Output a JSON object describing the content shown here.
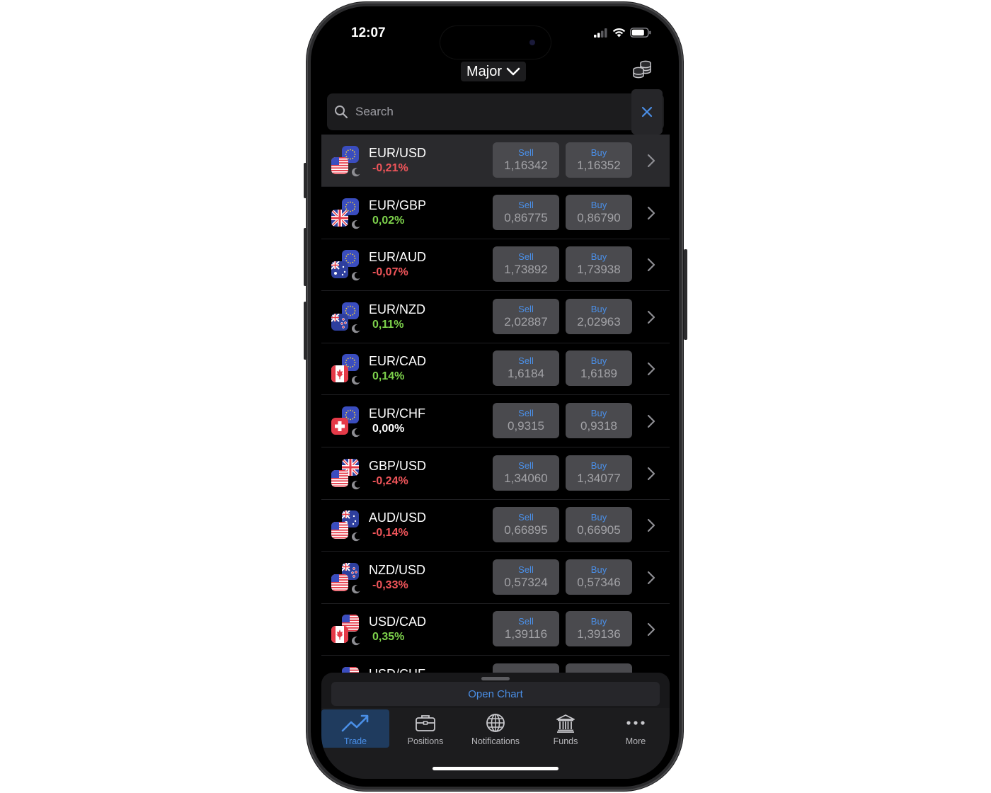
{
  "status": {
    "time": "12:07"
  },
  "header": {
    "market": "Major"
  },
  "search": {
    "placeholder": "Search"
  },
  "pairs": [
    {
      "symbol": "EUR/USD",
      "change": "-0,21%",
      "trend": "neg",
      "sell": "1,16342",
      "buy": "1,16352",
      "base": "eu",
      "quote": "us"
    },
    {
      "symbol": "EUR/GBP",
      "change": "0,02%",
      "trend": "pos",
      "sell": "0,86775",
      "buy": "0,86790",
      "base": "eu",
      "quote": "gb"
    },
    {
      "symbol": "EUR/AUD",
      "change": "-0,07%",
      "trend": "neg",
      "sell": "1,73892",
      "buy": "1,73938",
      "base": "eu",
      "quote": "au"
    },
    {
      "symbol": "EUR/NZD",
      "change": "0,11%",
      "trend": "pos",
      "sell": "2,02887",
      "buy": "2,02963",
      "base": "eu",
      "quote": "nz"
    },
    {
      "symbol": "EUR/CAD",
      "change": "0,14%",
      "trend": "pos",
      "sell": "1,6184",
      "buy": "1,6189",
      "base": "eu",
      "quote": "ca"
    },
    {
      "symbol": "EUR/CHF",
      "change": "0,00%",
      "trend": "neu",
      "sell": "0,9315",
      "buy": "0,9318",
      "base": "eu",
      "quote": "ch"
    },
    {
      "symbol": "GBP/USD",
      "change": "-0,24%",
      "trend": "neg",
      "sell": "1,34060",
      "buy": "1,34077",
      "base": "gb",
      "quote": "us"
    },
    {
      "symbol": "AUD/USD",
      "change": "-0,14%",
      "trend": "neg",
      "sell": "0,66895",
      "buy": "0,66905",
      "base": "au",
      "quote": "us"
    },
    {
      "symbol": "NZD/USD",
      "change": "-0,33%",
      "trend": "neg",
      "sell": "0,57324",
      "buy": "0,57346",
      "base": "nz",
      "quote": "us"
    },
    {
      "symbol": "USD/CAD",
      "change": "0,35%",
      "trend": "pos",
      "sell": "1,39116",
      "buy": "1,39136",
      "base": "us",
      "quote": "ca"
    },
    {
      "symbol": "USD/CHF",
      "change": "",
      "trend": "neu",
      "sell": "",
      "buy": "",
      "base": "us",
      "quote": "ch"
    }
  ],
  "labels": {
    "sell": "Sell",
    "buy": "Buy"
  },
  "sheet": {
    "open_chart": "Open Chart"
  },
  "tabs": [
    {
      "label": "Trade",
      "icon": "trend-chart-icon",
      "active": true
    },
    {
      "label": "Positions",
      "icon": "briefcase-icon",
      "active": false
    },
    {
      "label": "Notifications",
      "icon": "globe-icon",
      "active": false
    },
    {
      "label": "Funds",
      "icon": "bank-icon",
      "active": false
    },
    {
      "label": "More",
      "icon": "more-dots-icon",
      "active": false
    }
  ],
  "colors": {
    "negative": "#f0555a",
    "positive": "#7ed34c",
    "accent": "#4a8fe7"
  }
}
